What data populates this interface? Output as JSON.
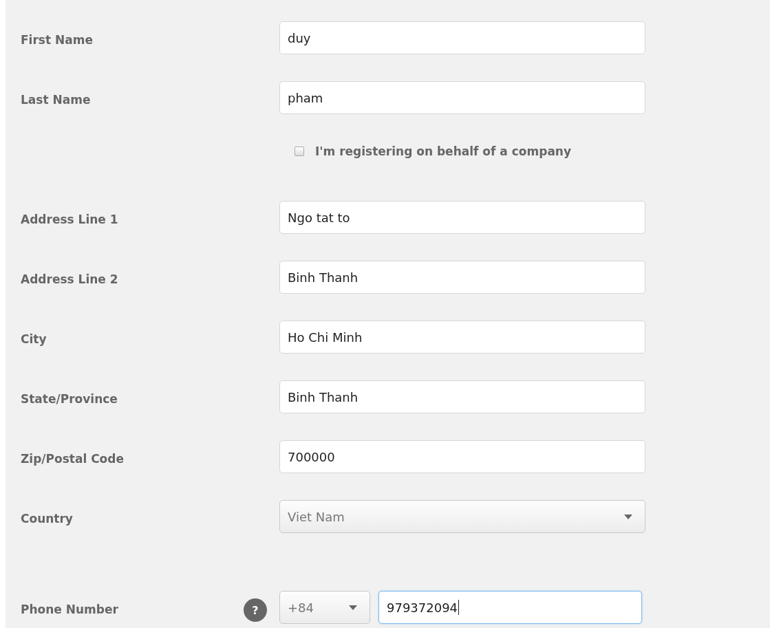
{
  "form": {
    "rows": [
      {
        "kind": "text",
        "label": "First Name",
        "value": "duy"
      },
      {
        "kind": "text",
        "label": "Last Name",
        "value": "pham"
      },
      {
        "kind": "checkbox",
        "text": "I'm registering on behalf of a company",
        "checked": false
      },
      {
        "kind": "text",
        "label": "Address Line 1",
        "value": "Ngo tat to"
      },
      {
        "kind": "text",
        "label": "Address Line 2",
        "value": "Binh Thanh"
      },
      {
        "kind": "text",
        "label": "City",
        "value": "Ho Chi Minh"
      },
      {
        "kind": "text",
        "label": "State/Province",
        "value": "Binh Thanh"
      },
      {
        "kind": "text",
        "label": "Zip/Postal Code",
        "value": "700000"
      },
      {
        "kind": "select",
        "label": "Country",
        "value": "Viet Nam"
      },
      {
        "kind": "phone",
        "label": "Phone Number",
        "help": "?",
        "code": "+84",
        "value": "979372094",
        "focused": true
      }
    ]
  }
}
